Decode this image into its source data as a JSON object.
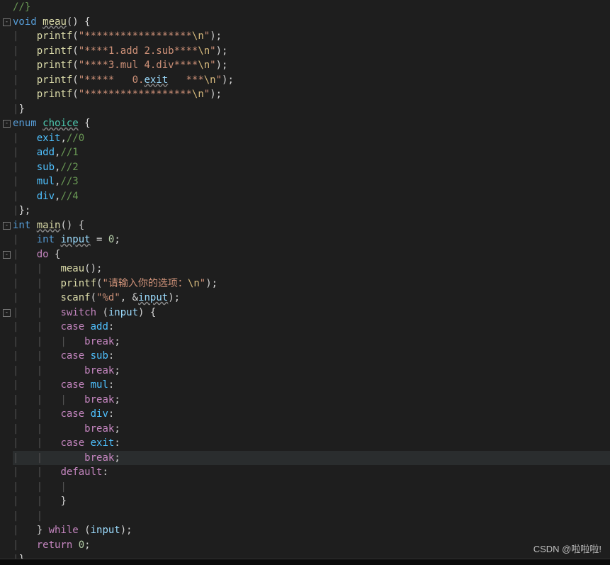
{
  "lines": [
    {
      "seg": [
        [
          "cmt",
          "//}"
        ]
      ]
    },
    {
      "seg": [
        [
          "kw",
          "void"
        ],
        [
          "op",
          " "
        ],
        [
          "fnU",
          "meau"
        ],
        [
          "op",
          "() {"
        ]
      ]
    },
    {
      "seg": [
        [
          "guide",
          "|   "
        ],
        [
          "fn",
          "printf"
        ],
        [
          "op",
          "("
        ],
        [
          "str",
          "\"******************"
        ],
        [
          "esc",
          "\\n"
        ],
        [
          "str",
          "\""
        ],
        [
          "op",
          ");"
        ]
      ]
    },
    {
      "seg": [
        [
          "guide",
          "|   "
        ],
        [
          "fn",
          "printf"
        ],
        [
          "op",
          "("
        ],
        [
          "str",
          "\"****1.add 2.sub****"
        ],
        [
          "esc",
          "\\n"
        ],
        [
          "str",
          "\""
        ],
        [
          "op",
          ");"
        ]
      ]
    },
    {
      "seg": [
        [
          "guide",
          "|   "
        ],
        [
          "fn",
          "printf"
        ],
        [
          "op",
          "("
        ],
        [
          "str",
          "\"****3.mul 4.div****"
        ],
        [
          "esc",
          "\\n"
        ],
        [
          "str",
          "\""
        ],
        [
          "op",
          ");"
        ]
      ]
    },
    {
      "seg": [
        [
          "guide",
          "|   "
        ],
        [
          "fn",
          "printf"
        ],
        [
          "op",
          "("
        ],
        [
          "str",
          "\"*****   0."
        ],
        [
          "idU",
          "exit"
        ],
        [
          "str",
          "   ***"
        ],
        [
          "esc",
          "\\n"
        ],
        [
          "str",
          "\""
        ],
        [
          "op",
          ");"
        ]
      ]
    },
    {
      "seg": [
        [
          "guide",
          "|   "
        ],
        [
          "fn",
          "printf"
        ],
        [
          "op",
          "("
        ],
        [
          "str",
          "\"******************"
        ],
        [
          "esc",
          "\\n"
        ],
        [
          "str",
          "\""
        ],
        [
          "op",
          ");"
        ]
      ]
    },
    {
      "seg": [
        [
          "guide",
          "|"
        ],
        [
          "op",
          "}"
        ]
      ]
    },
    {
      "seg": [
        [
          "kw",
          "enum"
        ],
        [
          "op",
          " "
        ],
        [
          "typeU",
          "choice"
        ],
        [
          "op",
          " {"
        ]
      ]
    },
    {
      "seg": [
        [
          "guide",
          "|   "
        ],
        [
          "enumc",
          "exit"
        ],
        [
          "op",
          ","
        ],
        [
          "cmt",
          "//0"
        ]
      ]
    },
    {
      "seg": [
        [
          "guide",
          "|   "
        ],
        [
          "enumc",
          "add"
        ],
        [
          "op",
          ","
        ],
        [
          "cmt",
          "//1"
        ]
      ]
    },
    {
      "seg": [
        [
          "guide",
          "|   "
        ],
        [
          "enumc",
          "sub"
        ],
        [
          "op",
          ","
        ],
        [
          "cmt",
          "//2"
        ]
      ]
    },
    {
      "seg": [
        [
          "guide",
          "|   "
        ],
        [
          "enumc",
          "mul"
        ],
        [
          "op",
          ","
        ],
        [
          "cmt",
          "//3"
        ]
      ]
    },
    {
      "seg": [
        [
          "guide",
          "|   "
        ],
        [
          "enumc",
          "div"
        ],
        [
          "op",
          ","
        ],
        [
          "cmt",
          "//4"
        ]
      ]
    },
    {
      "seg": [
        [
          "guide",
          "|"
        ],
        [
          "op",
          "};"
        ]
      ]
    },
    {
      "seg": [
        [
          "kw",
          "int"
        ],
        [
          "op",
          " "
        ],
        [
          "fnU",
          "main"
        ],
        [
          "op",
          "() {"
        ]
      ]
    },
    {
      "seg": [
        [
          "guide",
          "|   "
        ],
        [
          "kw",
          "int"
        ],
        [
          "op",
          " "
        ],
        [
          "idU",
          "input"
        ],
        [
          "op",
          " = "
        ],
        [
          "num",
          "0"
        ],
        [
          "op",
          ";"
        ]
      ]
    },
    {
      "seg": [
        [
          "guide",
          "|   "
        ],
        [
          "purple",
          "do"
        ],
        [
          "op",
          " {"
        ]
      ]
    },
    {
      "seg": [
        [
          "guide",
          "|   |   "
        ],
        [
          "fn",
          "meau"
        ],
        [
          "op",
          "();"
        ]
      ]
    },
    {
      "seg": [
        [
          "guide",
          "|   |   "
        ],
        [
          "fn",
          "printf"
        ],
        [
          "op",
          "("
        ],
        [
          "str",
          "\"请输入你的选项："
        ],
        [
          "esc",
          "\\n"
        ],
        [
          "str",
          "\""
        ],
        [
          "op",
          ");"
        ]
      ]
    },
    {
      "seg": [
        [
          "guide",
          "|   |   "
        ],
        [
          "fn",
          "scanf"
        ],
        [
          "op",
          "("
        ],
        [
          "str",
          "\"%d\""
        ],
        [
          "op",
          ", &"
        ],
        [
          "idU",
          "input"
        ],
        [
          "op",
          ");"
        ]
      ]
    },
    {
      "seg": [
        [
          "guide",
          "|   |   "
        ],
        [
          "purple",
          "switch"
        ],
        [
          "op",
          " ("
        ],
        [
          "id",
          "input"
        ],
        [
          "op",
          ") {"
        ]
      ]
    },
    {
      "seg": [
        [
          "guide",
          "|   |   "
        ],
        [
          "purple",
          "case"
        ],
        [
          "op",
          " "
        ],
        [
          "enumc",
          "add"
        ],
        [
          "op",
          ":"
        ]
      ]
    },
    {
      "seg": [
        [
          "guide",
          "|   |   |   "
        ],
        [
          "purple",
          "break"
        ],
        [
          "op",
          ";"
        ]
      ]
    },
    {
      "seg": [
        [
          "guide",
          "|   |   "
        ],
        [
          "purple",
          "case"
        ],
        [
          "op",
          " "
        ],
        [
          "enumc",
          "sub"
        ],
        [
          "op",
          ":"
        ]
      ]
    },
    {
      "seg": [
        [
          "guide",
          "|   |       "
        ],
        [
          "purple",
          "break"
        ],
        [
          "op",
          ";"
        ]
      ]
    },
    {
      "seg": [
        [
          "guide",
          "|   |   "
        ],
        [
          "purple",
          "case"
        ],
        [
          "op",
          " "
        ],
        [
          "enumc",
          "mul"
        ],
        [
          "op",
          ":"
        ]
      ]
    },
    {
      "seg": [
        [
          "guide",
          "|   |   |   "
        ],
        [
          "purple",
          "break"
        ],
        [
          "op",
          ";"
        ]
      ]
    },
    {
      "seg": [
        [
          "guide",
          "|   |   "
        ],
        [
          "purple",
          "case"
        ],
        [
          "op",
          " "
        ],
        [
          "enumc",
          "div"
        ],
        [
          "op",
          ":"
        ]
      ]
    },
    {
      "seg": [
        [
          "guide",
          "|   |       "
        ],
        [
          "purple",
          "break"
        ],
        [
          "op",
          ";"
        ]
      ]
    },
    {
      "seg": [
        [
          "guide",
          "|   |   "
        ],
        [
          "purple",
          "case"
        ],
        [
          "op",
          " "
        ],
        [
          "enumc",
          "exit"
        ],
        [
          "op",
          ":"
        ]
      ]
    },
    {
      "seg": [
        [
          "guide",
          "|   |       "
        ],
        [
          "purple",
          "break"
        ],
        [
          "op",
          ";"
        ]
      ]
    },
    {
      "seg": [
        [
          "guide",
          "|   |   "
        ],
        [
          "purple",
          "default"
        ],
        [
          "op",
          ":"
        ]
      ]
    },
    {
      "seg": [
        [
          "guide",
          "|   |   |"
        ]
      ]
    },
    {
      "seg": [
        [
          "guide",
          "|   |   "
        ],
        [
          "op",
          "}"
        ]
      ]
    },
    {
      "seg": [
        [
          "guide",
          "|   |"
        ]
      ]
    },
    {
      "seg": [
        [
          "guide",
          "|   "
        ],
        [
          "op",
          "} "
        ],
        [
          "purple",
          "while"
        ],
        [
          "op",
          " ("
        ],
        [
          "id",
          "input"
        ],
        [
          "op",
          ");"
        ]
      ]
    },
    {
      "seg": [
        [
          "guide",
          "|   "
        ],
        [
          "purple",
          "return"
        ],
        [
          "op",
          " "
        ],
        [
          "num",
          "0"
        ],
        [
          "op",
          ";"
        ]
      ]
    },
    {
      "seg": [
        [
          "guide",
          "|"
        ],
        [
          "op",
          "}"
        ]
      ]
    }
  ],
  "folds": [
    1,
    8,
    15,
    17,
    21
  ],
  "highlightedLineIndex": 31,
  "watermark": "CSDN @啦啦啦!"
}
